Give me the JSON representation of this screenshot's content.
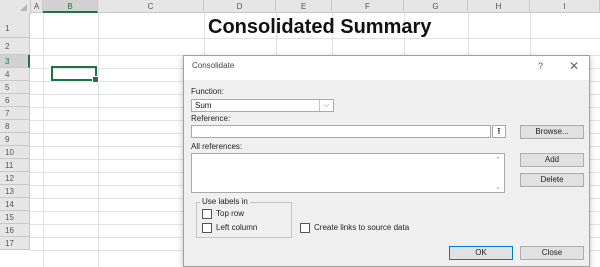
{
  "sheet": {
    "columns": [
      "A",
      "B",
      "C",
      "D",
      "E",
      "F",
      "G",
      "H",
      "I"
    ],
    "rows": [
      "1",
      "2",
      "3",
      "4",
      "5",
      "6",
      "7",
      "8",
      "9",
      "10",
      "11",
      "12",
      "13",
      "14",
      "15",
      "16",
      "17"
    ],
    "title": "Consolidated Summary",
    "selected_column": "B",
    "selected_row": "3"
  },
  "dialog": {
    "title": "Consolidate",
    "help": "?",
    "close": "✕",
    "function_label": "Function:",
    "function_accel": "F",
    "function_value": "Sum",
    "reference_label": "Reference:",
    "reference_accel": "R",
    "reference_value": "",
    "all_references_label": "All references:",
    "browse": "Browse...",
    "add": "Add",
    "delete": "Delete",
    "use_labels_in": "Use labels in",
    "top_row": "Top row",
    "left_column": "Left column",
    "create_links": "Create links to source data",
    "ok": "OK",
    "close_button": "Close"
  },
  "colors": {
    "accent": "#217346",
    "focus": "#0078d7"
  },
  "icons": {
    "combo_arrow": "chevron-down-icon",
    "ref_collapse": "collapse-up-icon"
  }
}
